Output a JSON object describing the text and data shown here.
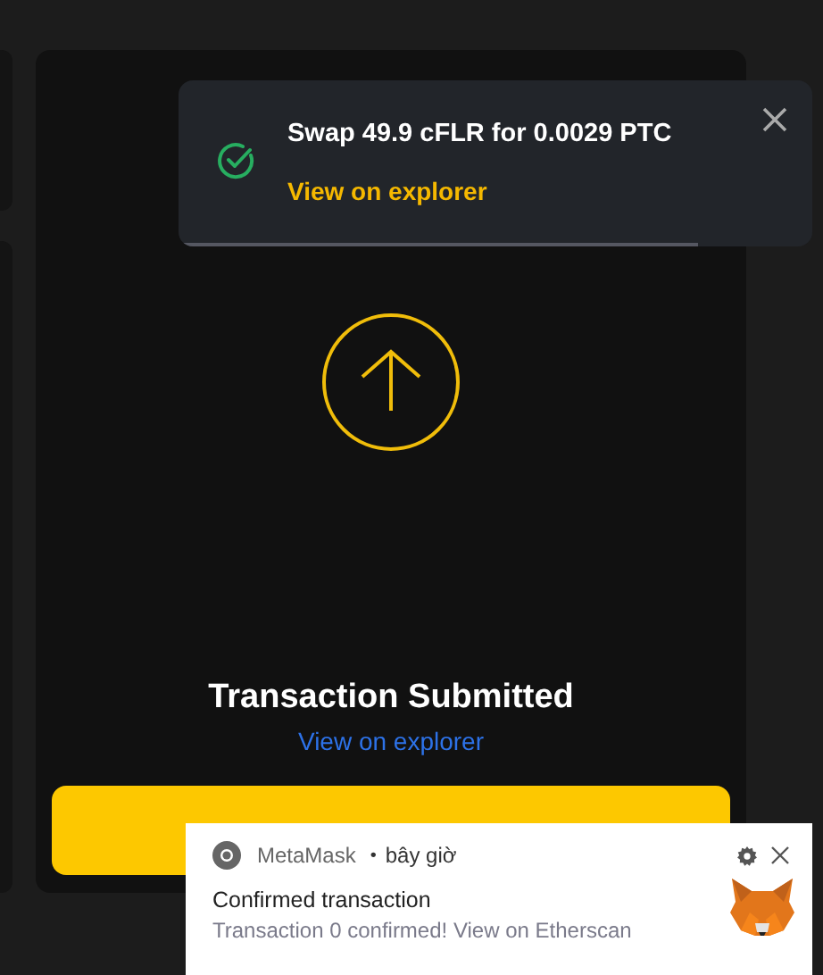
{
  "toast": {
    "title": "Swap 49.9 cFLR for 0.0029 PTC",
    "link": "View on explorer",
    "level": 0.82
  },
  "modal": {
    "title": "Transaction Submitted",
    "link": "View on explorer"
  },
  "notification": {
    "app": "MetaMask",
    "separator": "•",
    "time": "bây giờ",
    "title": "Confirmed transaction",
    "body": "Transaction 0 confirmed! View on Etherscan"
  }
}
